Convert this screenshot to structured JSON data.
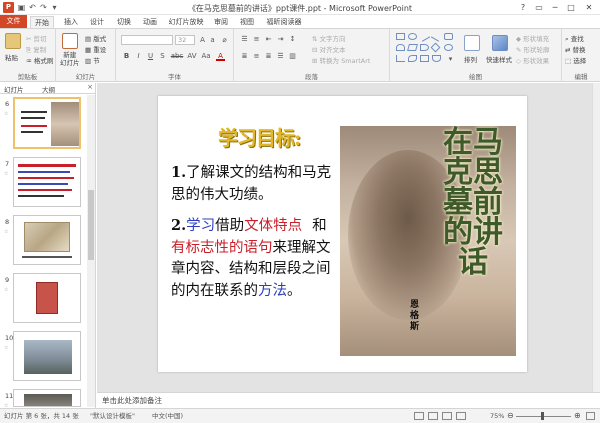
{
  "window": {
    "title": "《在马克思墓前的讲话》ppt课件.ppt - Microsoft PowerPoint",
    "app_icon": "P",
    "controls": {
      "help": "?",
      "restore": "▭",
      "minimize": "─",
      "maximize": "□",
      "close": "✕"
    }
  },
  "ribbon_tabs": [
    "文件",
    "开始",
    "插入",
    "设计",
    "切换",
    "动画",
    "幻灯片放映",
    "审阅",
    "视图",
    "福昕阅读器"
  ],
  "ribbon": {
    "clipboard": {
      "label": "剪贴板",
      "paste": "粘贴",
      "cut": "剪切",
      "copy": "复制",
      "format_painter": "格式刷"
    },
    "slides": {
      "label": "幻灯片",
      "new_slide": "新建\n幻灯片",
      "layout": "版式",
      "reset": "重设",
      "section": "节"
    },
    "font": {
      "label": "字体",
      "font_size": "32",
      "buttons": [
        "B",
        "I",
        "U",
        "S",
        "abc",
        "AV",
        "Aa",
        "A"
      ]
    },
    "paragraph": {
      "label": "段落",
      "text_direction": "文字方向",
      "align_text": "对齐文本",
      "smartart": "转换为 SmartArt"
    },
    "drawing": {
      "label": "绘图",
      "arrange": "排列",
      "quick_styles": "快速样式",
      "shape_fill": "形状填充",
      "shape_outline": "形状轮廓",
      "shape_effects": "形状效果"
    },
    "editing": {
      "label": "编辑",
      "find": "查找",
      "replace": "替换",
      "select": "选择"
    }
  },
  "panel": {
    "tabs": [
      "幻灯片",
      "大纲"
    ],
    "close": "×",
    "thumbnails": [
      {
        "num": "6",
        "star": "☆"
      },
      {
        "num": "7",
        "star": "☆"
      },
      {
        "num": "8",
        "star": "☆"
      },
      {
        "num": "9",
        "star": "☆"
      },
      {
        "num": "10",
        "star": "☆"
      },
      {
        "num": "11",
        "star": "☆"
      }
    ]
  },
  "slide": {
    "title": "学习目标:",
    "point1": {
      "num": "1.",
      "text": "了解课文的结构和马克思的伟大功绩。"
    },
    "point2": {
      "num": "2.",
      "seg1": "学习",
      "seg2": "借助",
      "seg3": "文体特点",
      "seg4": "和",
      "seg5": "有标志性的语句",
      "seg6": "来理解文章内容、结构和层段之间的内在联系的",
      "seg7": "方法",
      "seg8": "。"
    },
    "cover": {
      "title": "在马克思墓前的讲话",
      "author": "恩格斯"
    }
  },
  "notes": {
    "placeholder": "单击此处添加备注"
  },
  "status": {
    "slide_info": "幻灯片 第 6 张，共 14 张",
    "theme": "\"默认设计模板\"",
    "language": "中文(中国)",
    "zoom": "75%",
    "zoom_fraction": 0.75,
    "zoom_minus": "⊖",
    "zoom_plus": "⊕"
  },
  "colors": {
    "accent": "#d24726",
    "link_blue": "#2d3fbf",
    "highlight_red": "#c8202a",
    "title_gold": "#e2b82a"
  }
}
